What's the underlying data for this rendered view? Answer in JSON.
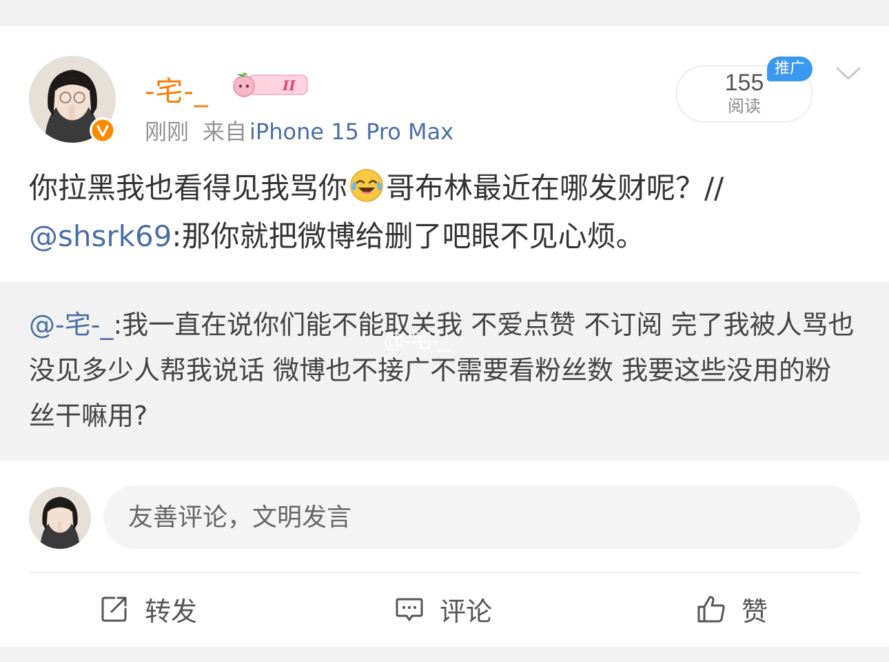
{
  "post": {
    "author": "-宅-_",
    "level": "II",
    "time": "刚刚",
    "via": "来自",
    "source": "iPhone 15 Pro Max",
    "reads": {
      "count": "155",
      "label": "阅读"
    },
    "promo_tag": "推广",
    "text_before_emoji": "你拉黑我也看得见我骂你",
    "text_after_emoji": "哥布林最近在哪发财呢？//",
    "forward_mention": "@shsrk69",
    "forward_text": ":那你就把微博给删了吧眼不见心烦。",
    "emoji": "laugh-crying-emoji"
  },
  "repost": {
    "mention": "@-宅-_",
    "text": ":我一直在说你们能不能取关我 不爱点赞 不订阅 完了我被人骂也没见多少人帮我说话 微博也不接广不需要看粉丝数 我要这些没用的粉丝干嘛用?",
    "watermark": "@-宅-_"
  },
  "comment_box": {
    "placeholder": "友善评论，文明发言"
  },
  "actions": {
    "repost": "转发",
    "comment": "评论",
    "like": "赞"
  },
  "colors": {
    "username": "#ff7a00",
    "link": "#4a6fa5",
    "promo": "#3b98f0",
    "verified": "#ff8a00"
  }
}
